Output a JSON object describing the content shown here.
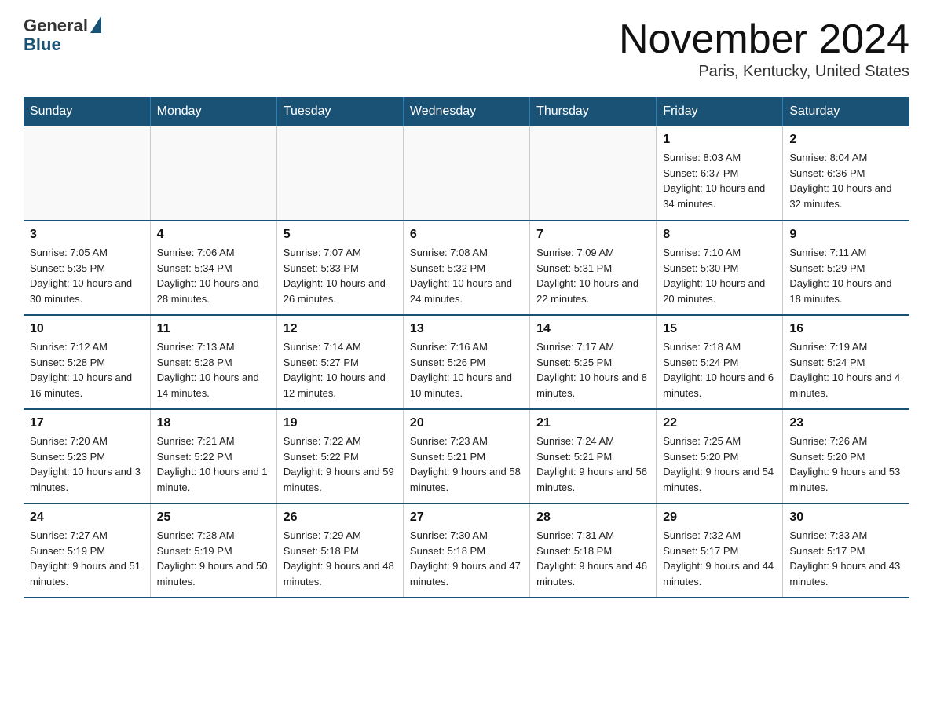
{
  "logo": {
    "general": "General",
    "blue": "Blue"
  },
  "title": "November 2024",
  "location": "Paris, Kentucky, United States",
  "days_of_week": [
    "Sunday",
    "Monday",
    "Tuesday",
    "Wednesday",
    "Thursday",
    "Friday",
    "Saturday"
  ],
  "weeks": [
    [
      {
        "day": "",
        "info": ""
      },
      {
        "day": "",
        "info": ""
      },
      {
        "day": "",
        "info": ""
      },
      {
        "day": "",
        "info": ""
      },
      {
        "day": "",
        "info": ""
      },
      {
        "day": "1",
        "info": "Sunrise: 8:03 AM\nSunset: 6:37 PM\nDaylight: 10 hours and 34 minutes."
      },
      {
        "day": "2",
        "info": "Sunrise: 8:04 AM\nSunset: 6:36 PM\nDaylight: 10 hours and 32 minutes."
      }
    ],
    [
      {
        "day": "3",
        "info": "Sunrise: 7:05 AM\nSunset: 5:35 PM\nDaylight: 10 hours and 30 minutes."
      },
      {
        "day": "4",
        "info": "Sunrise: 7:06 AM\nSunset: 5:34 PM\nDaylight: 10 hours and 28 minutes."
      },
      {
        "day": "5",
        "info": "Sunrise: 7:07 AM\nSunset: 5:33 PM\nDaylight: 10 hours and 26 minutes."
      },
      {
        "day": "6",
        "info": "Sunrise: 7:08 AM\nSunset: 5:32 PM\nDaylight: 10 hours and 24 minutes."
      },
      {
        "day": "7",
        "info": "Sunrise: 7:09 AM\nSunset: 5:31 PM\nDaylight: 10 hours and 22 minutes."
      },
      {
        "day": "8",
        "info": "Sunrise: 7:10 AM\nSunset: 5:30 PM\nDaylight: 10 hours and 20 minutes."
      },
      {
        "day": "9",
        "info": "Sunrise: 7:11 AM\nSunset: 5:29 PM\nDaylight: 10 hours and 18 minutes."
      }
    ],
    [
      {
        "day": "10",
        "info": "Sunrise: 7:12 AM\nSunset: 5:28 PM\nDaylight: 10 hours and 16 minutes."
      },
      {
        "day": "11",
        "info": "Sunrise: 7:13 AM\nSunset: 5:28 PM\nDaylight: 10 hours and 14 minutes."
      },
      {
        "day": "12",
        "info": "Sunrise: 7:14 AM\nSunset: 5:27 PM\nDaylight: 10 hours and 12 minutes."
      },
      {
        "day": "13",
        "info": "Sunrise: 7:16 AM\nSunset: 5:26 PM\nDaylight: 10 hours and 10 minutes."
      },
      {
        "day": "14",
        "info": "Sunrise: 7:17 AM\nSunset: 5:25 PM\nDaylight: 10 hours and 8 minutes."
      },
      {
        "day": "15",
        "info": "Sunrise: 7:18 AM\nSunset: 5:24 PM\nDaylight: 10 hours and 6 minutes."
      },
      {
        "day": "16",
        "info": "Sunrise: 7:19 AM\nSunset: 5:24 PM\nDaylight: 10 hours and 4 minutes."
      }
    ],
    [
      {
        "day": "17",
        "info": "Sunrise: 7:20 AM\nSunset: 5:23 PM\nDaylight: 10 hours and 3 minutes."
      },
      {
        "day": "18",
        "info": "Sunrise: 7:21 AM\nSunset: 5:22 PM\nDaylight: 10 hours and 1 minute."
      },
      {
        "day": "19",
        "info": "Sunrise: 7:22 AM\nSunset: 5:22 PM\nDaylight: 9 hours and 59 minutes."
      },
      {
        "day": "20",
        "info": "Sunrise: 7:23 AM\nSunset: 5:21 PM\nDaylight: 9 hours and 58 minutes."
      },
      {
        "day": "21",
        "info": "Sunrise: 7:24 AM\nSunset: 5:21 PM\nDaylight: 9 hours and 56 minutes."
      },
      {
        "day": "22",
        "info": "Sunrise: 7:25 AM\nSunset: 5:20 PM\nDaylight: 9 hours and 54 minutes."
      },
      {
        "day": "23",
        "info": "Sunrise: 7:26 AM\nSunset: 5:20 PM\nDaylight: 9 hours and 53 minutes."
      }
    ],
    [
      {
        "day": "24",
        "info": "Sunrise: 7:27 AM\nSunset: 5:19 PM\nDaylight: 9 hours and 51 minutes."
      },
      {
        "day": "25",
        "info": "Sunrise: 7:28 AM\nSunset: 5:19 PM\nDaylight: 9 hours and 50 minutes."
      },
      {
        "day": "26",
        "info": "Sunrise: 7:29 AM\nSunset: 5:18 PM\nDaylight: 9 hours and 48 minutes."
      },
      {
        "day": "27",
        "info": "Sunrise: 7:30 AM\nSunset: 5:18 PM\nDaylight: 9 hours and 47 minutes."
      },
      {
        "day": "28",
        "info": "Sunrise: 7:31 AM\nSunset: 5:18 PM\nDaylight: 9 hours and 46 minutes."
      },
      {
        "day": "29",
        "info": "Sunrise: 7:32 AM\nSunset: 5:17 PM\nDaylight: 9 hours and 44 minutes."
      },
      {
        "day": "30",
        "info": "Sunrise: 7:33 AM\nSunset: 5:17 PM\nDaylight: 9 hours and 43 minutes."
      }
    ]
  ]
}
